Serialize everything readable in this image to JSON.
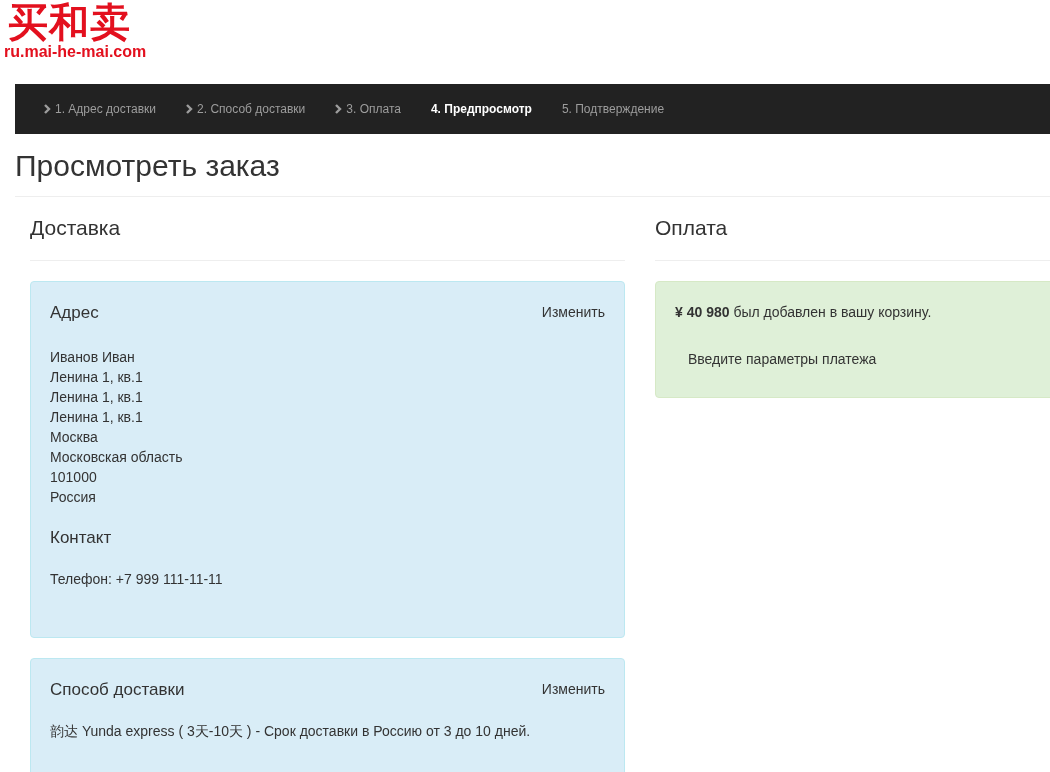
{
  "logo": {
    "mark": "买和卖",
    "domain": "ru.mai-he-mai.com"
  },
  "steps": [
    {
      "label": "1. Адрес доставки",
      "completed": true,
      "selected": false
    },
    {
      "label": "2. Способ доставки",
      "completed": true,
      "selected": false
    },
    {
      "label": "3. Оплата",
      "completed": true,
      "selected": false
    },
    {
      "label": "4. Предпросмотр",
      "completed": false,
      "selected": true
    },
    {
      "label": "5. Подтверждение",
      "completed": false,
      "selected": false
    }
  ],
  "page_title": "Просмотреть заказ",
  "delivery": {
    "heading": "Доставка",
    "address_card": {
      "title": "Адрес",
      "edit_link": "Изменить",
      "lines": [
        "Иванов Иван",
        "Ленина 1, кв.1",
        "Ленина 1, кв.1",
        "Ленина 1, кв.1",
        "Москва",
        "Московская область",
        "101000",
        "Россия"
      ],
      "contact_title": "Контакт",
      "phone": "Телефон: +7 999 111-11-11"
    },
    "method_card": {
      "title": "Способ доставки",
      "edit_link": "Изменить",
      "description": "韵达 Yunda express ( 3天-10天 ) - Срок доставки в Россию от 3 до 10 дней."
    }
  },
  "payment": {
    "heading": "Оплата",
    "message": "**¥ 40 980** был добавлен в вашу корзину.",
    "prompt": "Введите параметры платежа"
  }
}
